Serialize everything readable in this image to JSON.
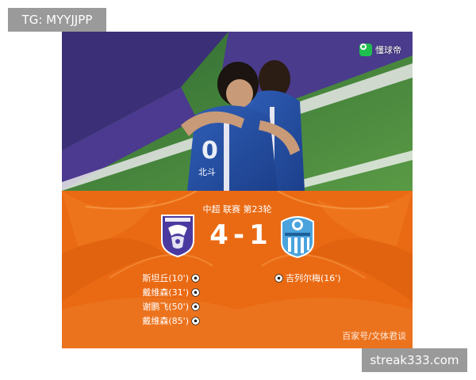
{
  "overlay": {
    "top_tag": "TG: MYYJJPP",
    "bottom_tag": "streak333.com"
  },
  "photo": {
    "app_name": "懂球帝",
    "jersey_text": "北斗"
  },
  "match": {
    "round_label": "中超 联赛 第23轮",
    "home_score": "4",
    "separator": "-",
    "away_score": "1",
    "home_scorers": [
      "斯坦丘(10')",
      "戴维森(31')",
      "谢鹏飞(50')",
      "戴维森(85')"
    ],
    "away_scorers": [
      "吉列尔梅(16')"
    ]
  },
  "watermark": "百家号/文体君谈",
  "colors": {
    "panel_orange": "#ea6a13",
    "home_crest": "#4a3aa0",
    "away_crest": "#4aa3dd"
  },
  "icons": {
    "ball": "soccer-ball-icon",
    "home_team": "home-team-crest",
    "away_team": "away-team-crest"
  }
}
